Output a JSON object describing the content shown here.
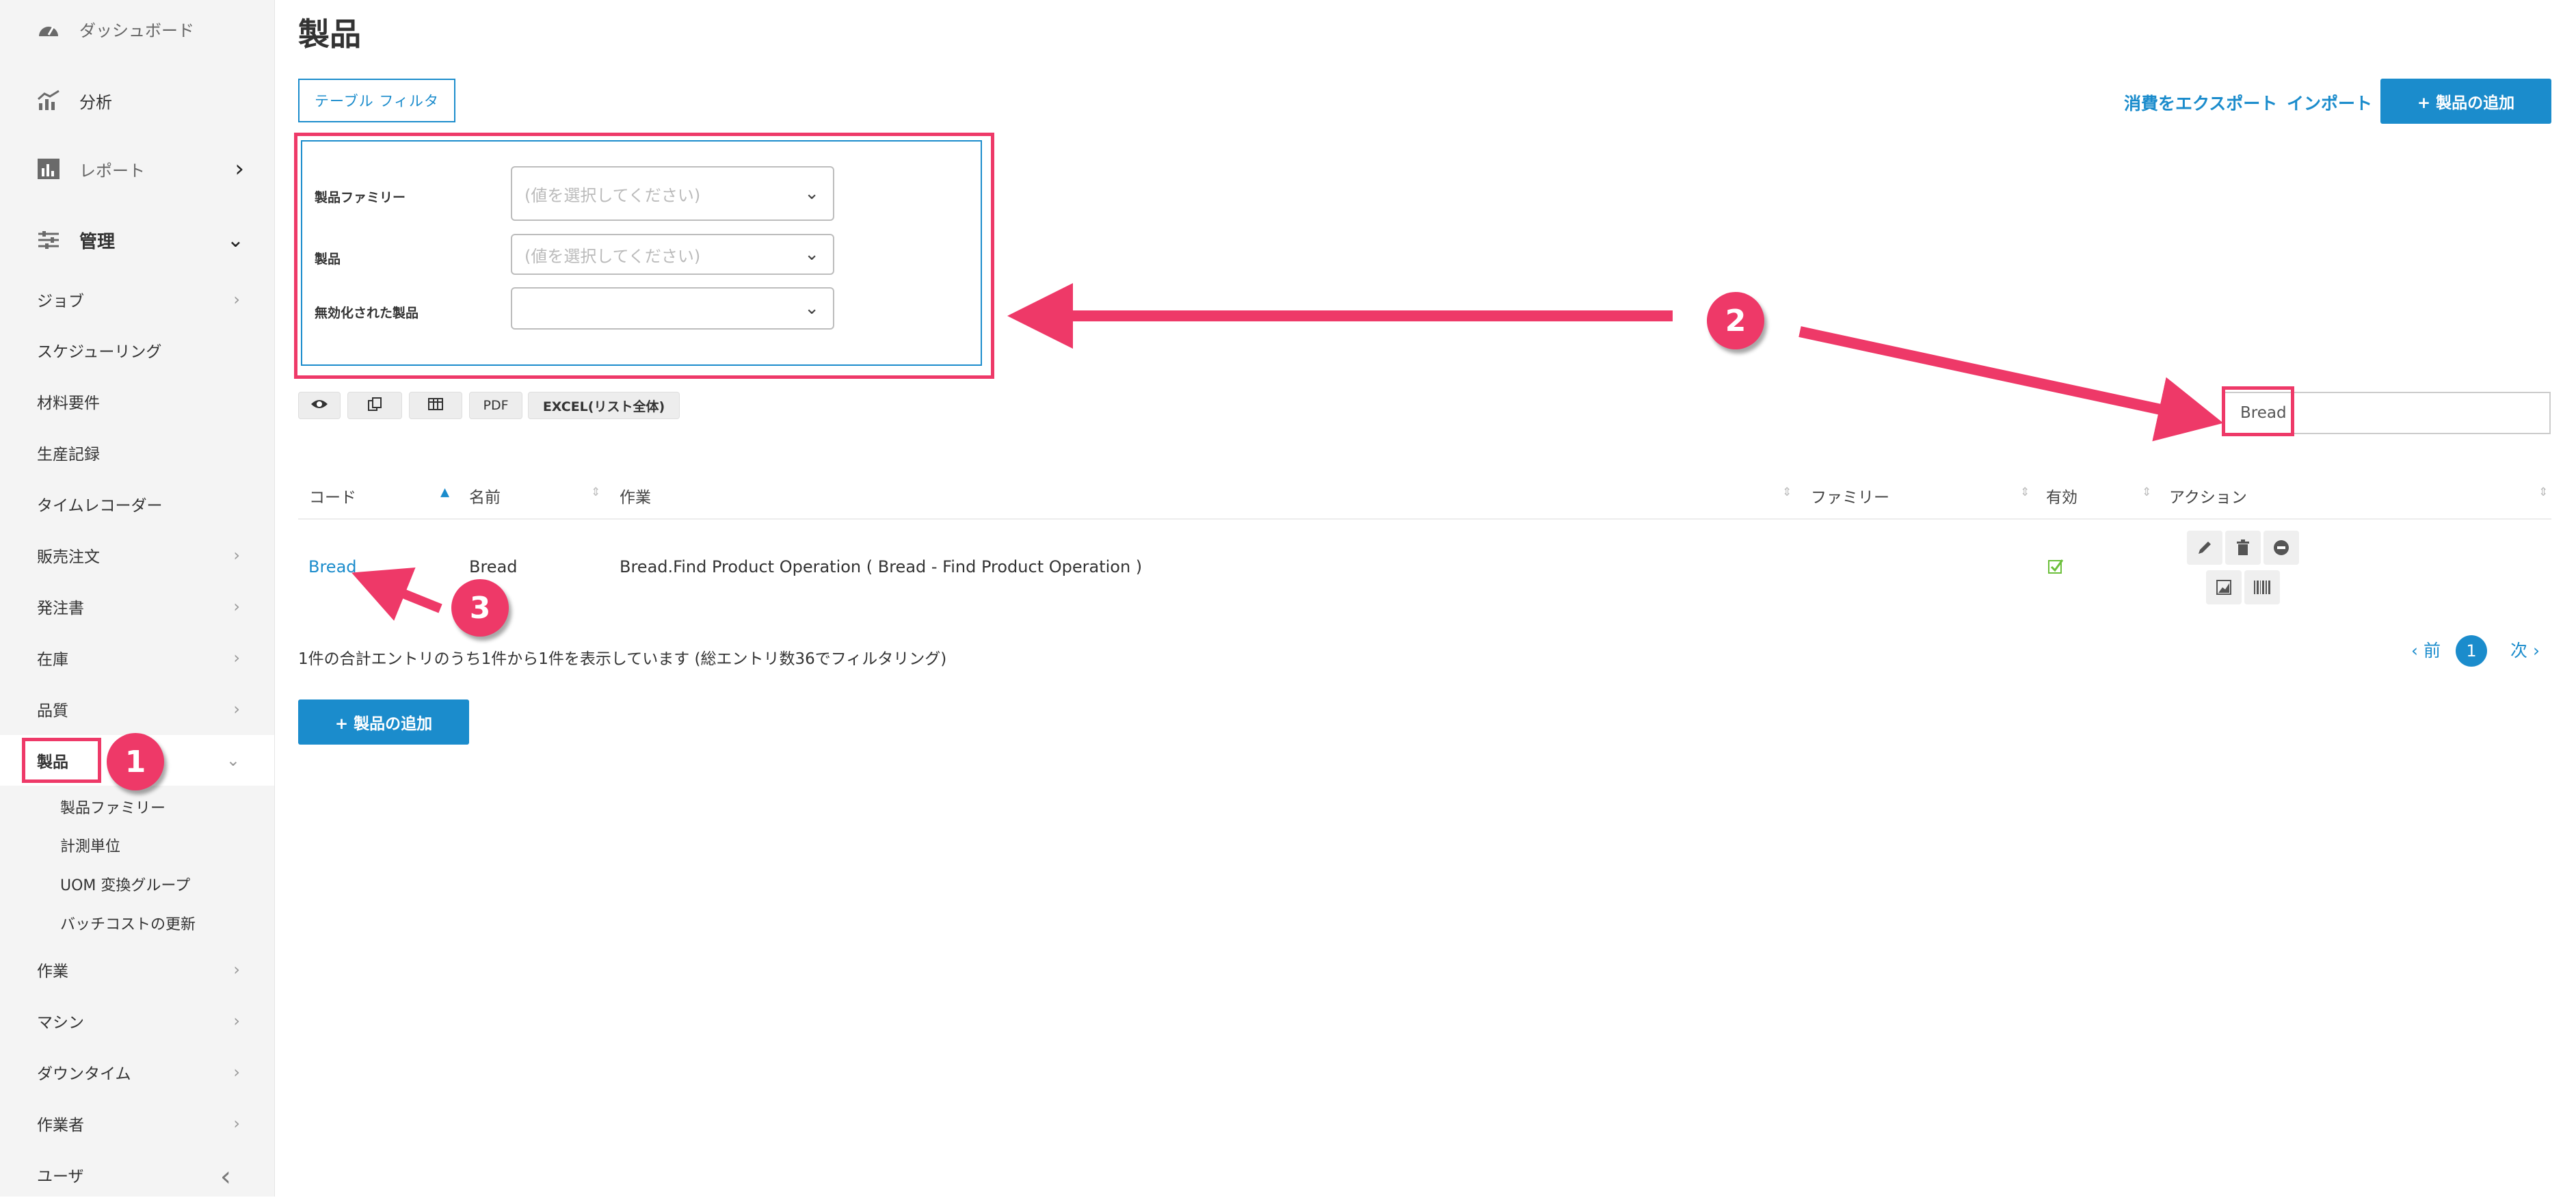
{
  "sidebar": {
    "dashboard": "ダッシュボード",
    "analytics": "分析",
    "reports": "レポート",
    "admin": "管理",
    "items": [
      {
        "label": "ジョブ"
      },
      {
        "label": "スケジューリング"
      },
      {
        "label": "材料要件"
      },
      {
        "label": "生産記録"
      },
      {
        "label": "タイムレコーダー"
      },
      {
        "label": "販売注文"
      },
      {
        "label": "発注書"
      },
      {
        "label": "在庫"
      },
      {
        "label": "品質"
      },
      {
        "label": "製品"
      }
    ],
    "sub_items": [
      {
        "label": "製品ファミリー"
      },
      {
        "label": "計測単位"
      },
      {
        "label": "UOM 変換グループ"
      },
      {
        "label": "バッチコストの更新"
      }
    ],
    "items_after": [
      {
        "label": "作業"
      },
      {
        "label": "マシン"
      },
      {
        "label": "ダウンタイム"
      },
      {
        "label": "作業者"
      },
      {
        "label": "ユーザ"
      }
    ]
  },
  "page": {
    "title": "製品",
    "filter_button": "テーブル フィルタ",
    "export_link": "消費をエクスポート",
    "import_link": "インポート",
    "add_product": "+ 製品の追加"
  },
  "filters": [
    {
      "label": "製品ファミリー",
      "placeholder": "(値を選択してください)"
    },
    {
      "label": "製品",
      "placeholder": "(値を選択してください)"
    },
    {
      "label": "無効化された製品",
      "placeholder": ""
    }
  ],
  "toolbar": {
    "pdf": "PDF",
    "excel": "EXCEL(リスト全体)"
  },
  "search": {
    "value": "Bread"
  },
  "table": {
    "headers": [
      "コード",
      "名前",
      "作業",
      "ファミリー",
      "有効",
      "アクション"
    ],
    "rows": [
      {
        "code": "Bread",
        "name": "Bread",
        "operation": "Bread.Find Product Operation ( Bread - Find Product Operation )",
        "family": "",
        "active": true
      }
    ]
  },
  "footer": {
    "info": "1件の合計エントリのうち1件から1件を表示しています (総エントリ数36でフィルタリング)",
    "prev": "‹ 前",
    "page": "1",
    "next": "次 ›"
  },
  "annotations": {
    "badge1": "1",
    "badge2": "2",
    "badge3": "3"
  },
  "colors": {
    "accent": "#1b8ccc",
    "annotation": "#ee3968",
    "active_check": "#6bbf3a"
  },
  "icons": [
    "dashboard-icon",
    "analytics-icon",
    "reports-icon",
    "admin-icon",
    "eye-icon",
    "copy-icon",
    "columns-icon",
    "edit-icon",
    "trash-icon",
    "disable-icon",
    "chart-icon",
    "barcode-icon",
    "check-icon"
  ]
}
